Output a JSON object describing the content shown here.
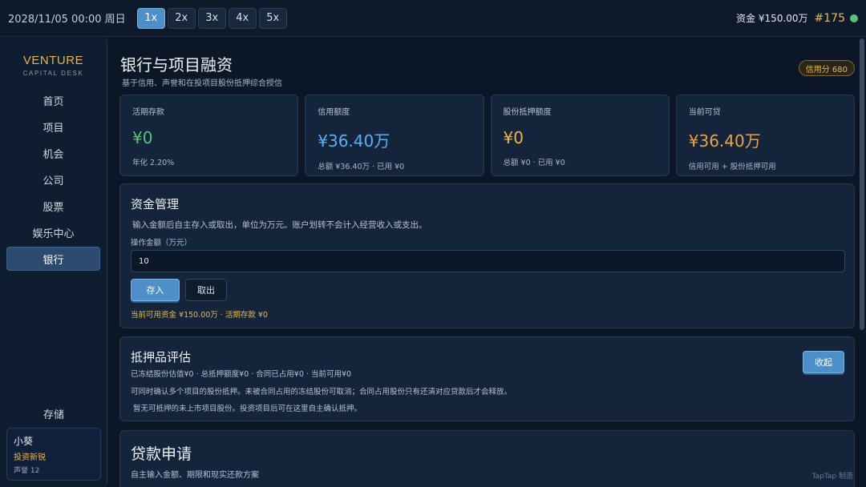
{
  "topbar": {
    "date": "2028/11/05 00:00 周日",
    "speeds": [
      "1x",
      "2x",
      "3x",
      "4x",
      "5x"
    ],
    "funds": "资金 ¥150.00万",
    "rank": "#175"
  },
  "sidebar": {
    "brand_title": "VENTURE",
    "brand_sub": "CAPITAL DESK",
    "items": [
      {
        "label": "首页"
      },
      {
        "label": "项目"
      },
      {
        "label": "机会"
      },
      {
        "label": "公司"
      },
      {
        "label": "股票"
      },
      {
        "label": "娱乐中心"
      },
      {
        "label": "银行"
      }
    ],
    "storage": "存储",
    "user": {
      "name": "小葵",
      "title": "投资新锐",
      "reputation": "声誉 12"
    }
  },
  "page": {
    "title": "银行与项目融资",
    "subtitle": "基于信用、声誉和在投项目股份抵押综合授信",
    "credit_badge": "信用分 680"
  },
  "stats": [
    {
      "label": "活期存款",
      "value": "¥0",
      "note": "年化 2.20%",
      "color": "#5cc27a"
    },
    {
      "label": "信用额度",
      "value": "¥36.40万",
      "note": "总额 ¥36.40万 · 已用 ¥0",
      "color": "#56b2ee"
    },
    {
      "label": "股份抵押额度",
      "value": "¥0",
      "note": "总额 ¥0 · 已用 ¥0",
      "color": "#e8b94a"
    },
    {
      "label": "当前可贷",
      "value": "¥36.40万",
      "note": "信用可用 + 股份抵押可用",
      "color": "#e8a448"
    }
  ],
  "funds_mgmt": {
    "title": "资金管理",
    "desc": "输入金额后自主存入或取出，单位为万元。账户划转不会计入经营收入或支出。",
    "input_label": "操作金额（万元）",
    "input_value": "10",
    "deposit": "存入",
    "withdraw": "取出",
    "status": "当前可用资金 ¥150.00万 · 活期存款 ¥0"
  },
  "collateral": {
    "title": "抵押品评估",
    "summary": "已冻结股份估值¥0 · 总抵押额度¥0 · 合同已占用¥0 · 当前可用¥0",
    "note1": "可同时确认多个项目的股份抵押。未被合同占用的冻结股份可取消；合同占用股份只有还清对应贷款后才会释放。",
    "note2": "暂无可抵押的未上市项目股份。投资项目后可在这里自主确认抵押。",
    "collapse": "收起"
  },
  "loan": {
    "title": "贷款申请",
    "subtitle": "自主输入金额、期限和现实还款方案"
  },
  "watermark": "TapTap 制造"
}
